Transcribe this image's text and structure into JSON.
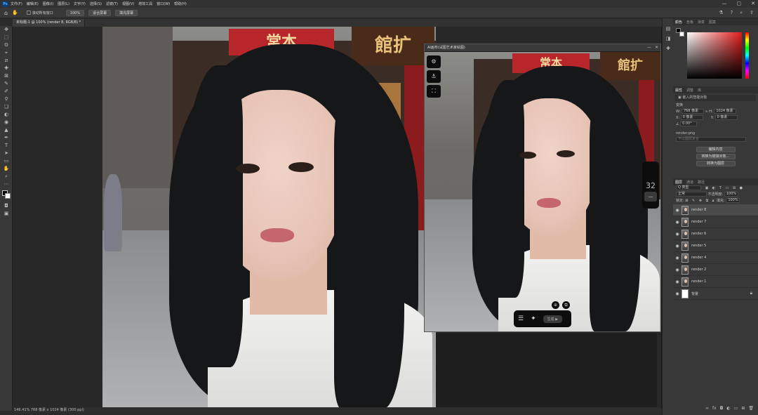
{
  "app": {
    "logo": "Ps"
  },
  "menu": [
    "文件(F)",
    "编辑(E)",
    "图像(I)",
    "图层(L)",
    "文字(Y)",
    "选择(S)",
    "滤镜(T)",
    "视图(V)",
    "增效工具",
    "窗口(W)",
    "帮助(H)"
  ],
  "window_controls": [
    "—",
    "▢",
    "✕"
  ],
  "options": {
    "scroll_all": "滚动所有窗口",
    "zoom": "100%",
    "fit_screen": "适合屏幕",
    "fill_screen": "填充屏幕"
  },
  "document_tab": "未标题-1 @ 100% (render 8, RGB/8) *",
  "tools": [
    "✥",
    "⬚",
    "ʘ",
    "⌖",
    "⧄",
    "✚",
    "⊠",
    "✎",
    "✐",
    "⚲",
    "❏",
    "◐",
    "◉",
    "▲",
    "✒",
    "T",
    "➤",
    "▭",
    "✋",
    "⌕",
    "⋯"
  ],
  "float_window": {
    "title": "AI画布(试图艺术家绘图)",
    "controls": [
      "—",
      "✕"
    ],
    "buttons": {
      "settings": "⚙",
      "anchor": "⚓",
      "fullscreen": "⛶"
    },
    "zoom_value": "32",
    "zoom_minus": "—",
    "bottom": {
      "list": "☰",
      "add": "✦",
      "generate": "生成 ▶"
    },
    "circle_btns": [
      "⊕",
      "⧉"
    ]
  },
  "status": "146.41%  768 像素 x 1024 像素 (300 ppi)",
  "panels": {
    "color_tabs": [
      "颜色",
      "色板",
      "渐变",
      "图案"
    ],
    "prop_tabs": [
      "属性",
      "调整",
      "库"
    ],
    "prop_title": "嵌入的智能对象",
    "transform_label": "变换",
    "w_label": "W:",
    "w_value": "768 像素",
    "h_label": "H:",
    "h_value": "1024 像素",
    "x_label": "X:",
    "x_value": "0 像素",
    "y_label": "Y:",
    "y_value": "0 像素",
    "angle_value": "0.00°",
    "file_name": "render.png",
    "layer_comp_placeholder": "不以图层复合",
    "edit_contents": "编辑内容",
    "convert_linked": "转换为链接对象...",
    "convert_layers": "转换为图层",
    "layer_tabs": [
      "图层",
      "通道",
      "路径"
    ],
    "kind_label": "Q 类型",
    "blend_mode": "正常",
    "opacity_label": "不透明度:",
    "opacity_value": "100%",
    "lock_label": "锁定:",
    "fill_label": "填充:",
    "fill_value": "100%",
    "layers": [
      {
        "name": "render 8",
        "selected": true
      },
      {
        "name": "render 7"
      },
      {
        "name": "render 6"
      },
      {
        "name": "render 5"
      },
      {
        "name": "render 4"
      },
      {
        "name": "render 2"
      },
      {
        "name": "render 1"
      },
      {
        "name": "背景",
        "white": true,
        "locked": true
      }
    ]
  }
}
